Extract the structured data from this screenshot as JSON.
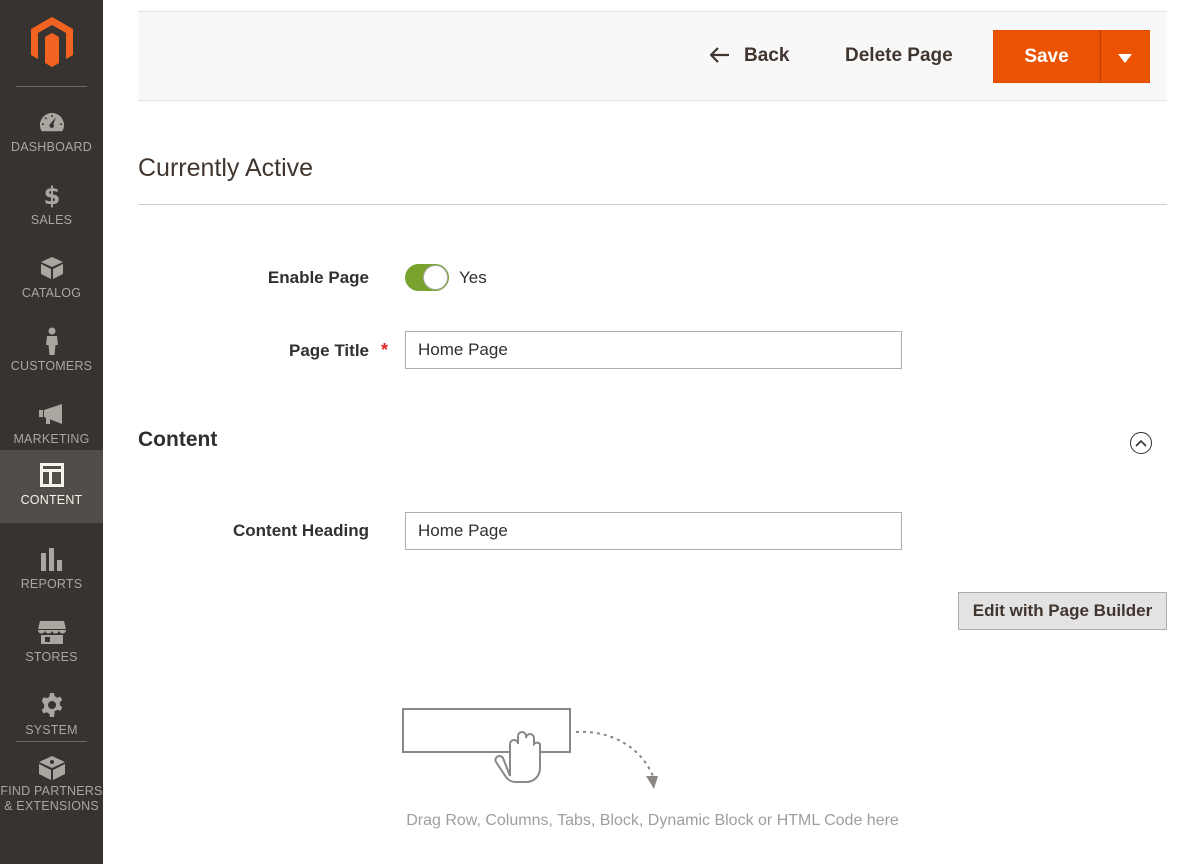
{
  "sidebar": {
    "items": [
      {
        "label": "DASHBOARD",
        "icon": "dashboard-icon"
      },
      {
        "label": "SALES",
        "icon": "dollar-icon"
      },
      {
        "label": "CATALOG",
        "icon": "cube-icon"
      },
      {
        "label": "CUSTOMERS",
        "icon": "person-icon"
      },
      {
        "label": "MARKETING",
        "icon": "megaphone-icon"
      },
      {
        "label": "CONTENT",
        "icon": "layout-icon",
        "active": true
      },
      {
        "label": "REPORTS",
        "icon": "bar-chart-icon"
      },
      {
        "label": "STORES",
        "icon": "storefront-icon"
      },
      {
        "label": "SYSTEM",
        "icon": "gear-icon"
      }
    ],
    "partners": {
      "line1": "FIND PARTNERS",
      "line2": "& EXTENSIONS",
      "icon": "blocks-icon"
    }
  },
  "actions": {
    "back_label": "Back",
    "delete_label": "Delete Page",
    "save_label": "Save"
  },
  "currently_active": {
    "title": "Currently Active",
    "enable_page_label": "Enable Page",
    "enable_page_value": "Yes",
    "enabled": true,
    "page_title_label": "Page Title",
    "page_title_value": "Home Page"
  },
  "content": {
    "title": "Content",
    "heading_label": "Content Heading",
    "heading_value": "Home Page",
    "page_builder_label": "Edit with Page Builder",
    "drop_hint": "Drag Row, Columns, Tabs, Block, Dynamic Block or HTML Code here"
  },
  "colors": {
    "sidebar_bg": "#373330",
    "sidebar_active": "#524d49",
    "accent": "#eb5202",
    "toggle_on": "#79a22e",
    "required": "#e22626"
  }
}
